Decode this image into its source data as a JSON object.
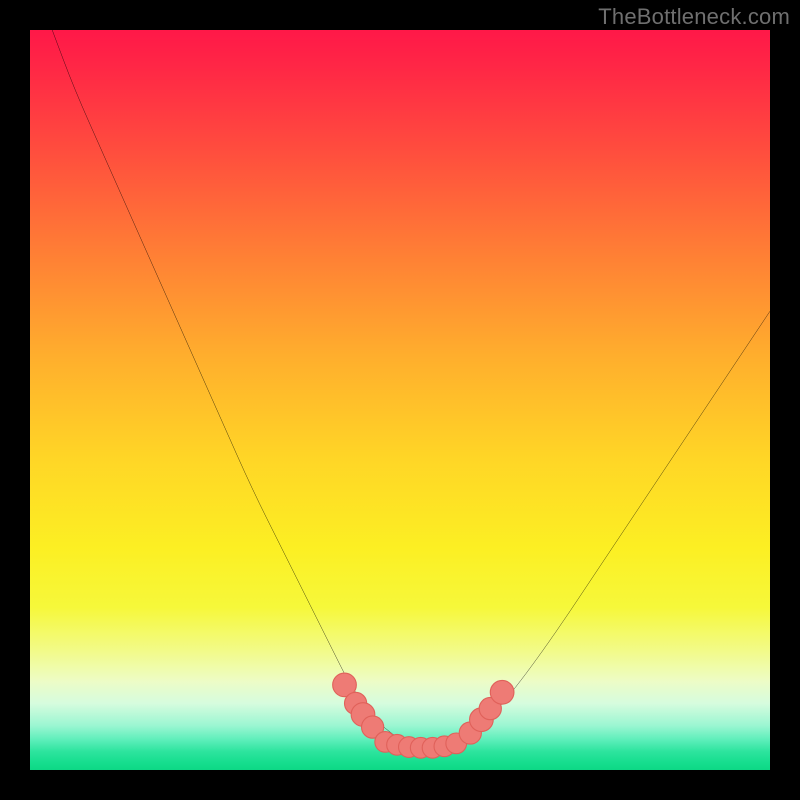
{
  "watermark": "TheBottleneck.com",
  "colors": {
    "frame": "#000000",
    "curve": "#000000",
    "marker_fill": "#ee7b75",
    "marker_stroke": "#e0615a",
    "gradient_stops": [
      "#ff1848",
      "#ff2a45",
      "#ff4c3e",
      "#ff7e35",
      "#ffae2d",
      "#ffd626",
      "#fcef23",
      "#f6f83a",
      "#f2fb8a",
      "#edfcc6",
      "#d6fcde",
      "#9bf6d2",
      "#5beeb9",
      "#2de49e",
      "#16de8e",
      "#0dd885"
    ]
  },
  "chart_data": {
    "type": "line",
    "title": "",
    "xlabel": "",
    "ylabel": "",
    "xlim": [
      0,
      100
    ],
    "ylim": [
      0,
      100
    ],
    "grid": false,
    "series": [
      {
        "name": "bottleneck-curve",
        "x": [
          3,
          6,
          10,
          14,
          18,
          22,
          26,
          30,
          34,
          38,
          41,
          43,
          45,
          47,
          49,
          51,
          53,
          55,
          57,
          60,
          64,
          70,
          78,
          88,
          100
        ],
        "y": [
          100,
          92,
          83,
          74,
          65,
          56,
          47,
          38,
          30,
          22,
          16,
          12,
          9,
          6.5,
          4.8,
          3.6,
          3.0,
          3.0,
          3.4,
          5.0,
          9,
          17,
          29,
          44,
          62
        ]
      }
    ],
    "marker_groups": [
      {
        "name": "left-cluster",
        "points": [
          {
            "x": 42.5,
            "y": 11.5,
            "r": 1.6
          },
          {
            "x": 44.0,
            "y": 9.0,
            "r": 1.5
          },
          {
            "x": 45.0,
            "y": 7.5,
            "r": 1.6
          },
          {
            "x": 46.3,
            "y": 5.8,
            "r": 1.5
          }
        ]
      },
      {
        "name": "valley-band",
        "points": [
          {
            "x": 48.0,
            "y": 3.8,
            "r": 1.4
          },
          {
            "x": 49.6,
            "y": 3.4,
            "r": 1.4
          },
          {
            "x": 51.2,
            "y": 3.1,
            "r": 1.4
          },
          {
            "x": 52.8,
            "y": 3.0,
            "r": 1.4
          },
          {
            "x": 54.4,
            "y": 3.0,
            "r": 1.4
          },
          {
            "x": 56.0,
            "y": 3.2,
            "r": 1.4
          },
          {
            "x": 57.6,
            "y": 3.6,
            "r": 1.4
          }
        ]
      },
      {
        "name": "right-cluster",
        "points": [
          {
            "x": 59.5,
            "y": 5.0,
            "r": 1.5
          },
          {
            "x": 61.0,
            "y": 6.8,
            "r": 1.6
          },
          {
            "x": 62.2,
            "y": 8.3,
            "r": 1.5
          },
          {
            "x": 63.8,
            "y": 10.5,
            "r": 1.6
          }
        ]
      }
    ]
  }
}
